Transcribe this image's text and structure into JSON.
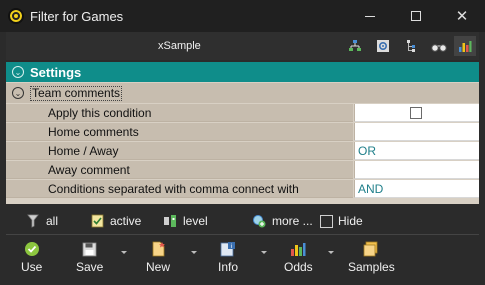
{
  "window": {
    "title": "Filter for Games",
    "minimize_icon": "minimize-icon",
    "maximize_icon": "maximize-icon",
    "close_glyph": "✕"
  },
  "toolbar": {
    "sample": "xSample",
    "icons": [
      "hierarchy-icon",
      "settings-gear-icon",
      "tree-icon",
      "binoculars-icon",
      "bar-chart-icon"
    ]
  },
  "panel": {
    "section_title": "Settings",
    "group_label": "Team comments",
    "rows": [
      {
        "label": "Apply this condition",
        "value": "",
        "checkbox": true
      },
      {
        "label": "Home comments",
        "value": ""
      },
      {
        "label": "Home / Away",
        "value": "OR"
      },
      {
        "label": "Away comment",
        "value": ""
      },
      {
        "label": "Conditions separated with comma connect with",
        "value": "AND"
      }
    ]
  },
  "filterbar": {
    "all": "all",
    "active": "active",
    "level": "level",
    "more": "more ...",
    "hide": "Hide"
  },
  "bottombar": {
    "use": "Use",
    "save": "Save",
    "new": "New",
    "info": "Info",
    "odds": "Odds",
    "samples": "Samples"
  },
  "colors": {
    "accent": "#0f8d8a",
    "value_text": "#1f7f8a",
    "panel_bg": "#c7bdaf"
  }
}
